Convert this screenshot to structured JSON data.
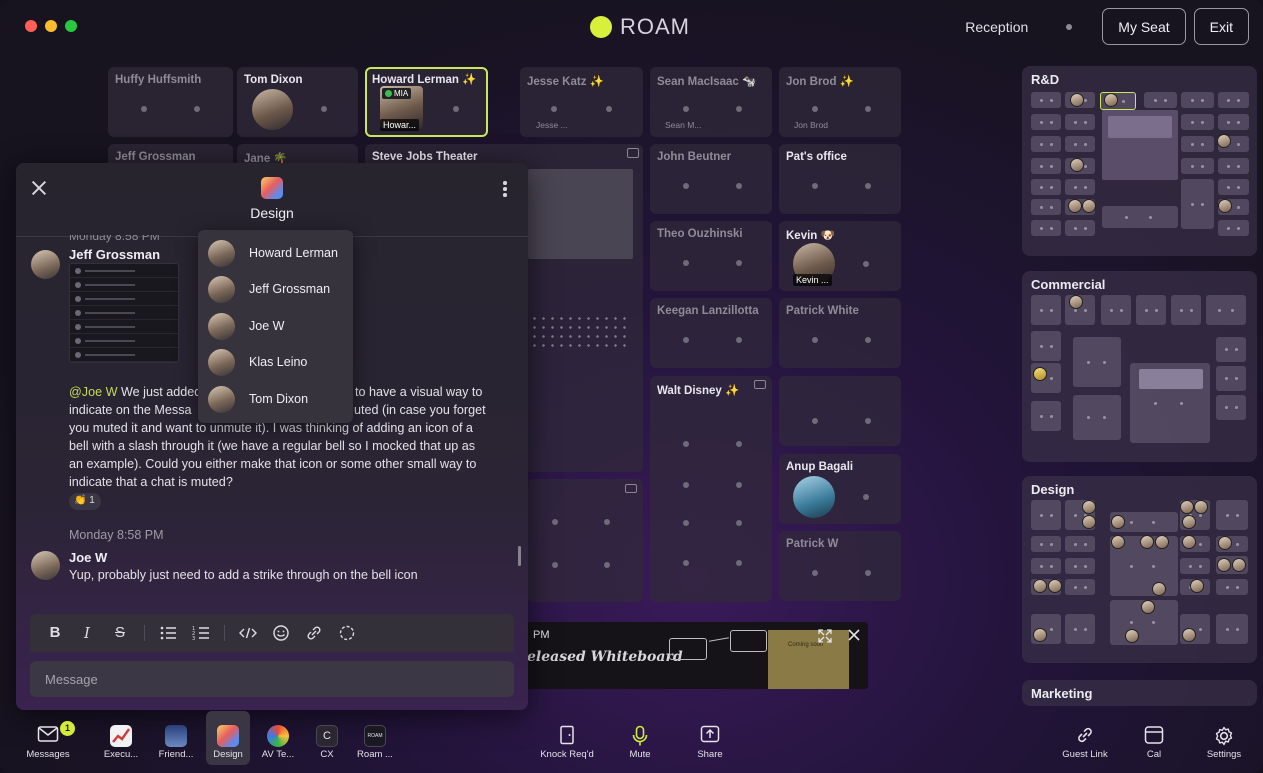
{
  "app": {
    "name": "ROAM",
    "location": "Reception"
  },
  "header": {
    "my_seat": "My Seat",
    "exit": "Exit"
  },
  "rooms": [
    {
      "name": "Huffy Huffsmith"
    },
    {
      "name": "Tom Dixon"
    },
    {
      "name": "Howard Lerman ✨",
      "badge": "MIA",
      "caption": "Howar..."
    },
    {
      "name": "Jesse Katz ✨",
      "caption": "Jesse ..."
    },
    {
      "name": "Sean MacIsaac 🐄",
      "caption": "Sean M..."
    },
    {
      "name": "Jon Brod ✨",
      "caption": "Jon Brod"
    },
    {
      "name": "Jeff Grossman"
    },
    {
      "name": "Jane 🌴"
    },
    {
      "name": "Steve Jobs Theater"
    },
    {
      "name": "John Beutner"
    },
    {
      "name": "Pat's office"
    },
    {
      "name": "Theo Ouzhinski"
    },
    {
      "name": "Kevin 🐶",
      "caption": "Kevin ..."
    },
    {
      "name": "Keegan Lanzillotta"
    },
    {
      "name": "Patrick White"
    },
    {
      "name": "Walt Disney ✨"
    },
    {
      "name": "Anup Bagali"
    },
    {
      "name": "Patrick W"
    }
  ],
  "floors": [
    {
      "name": "R&D"
    },
    {
      "name": "Commercial"
    },
    {
      "name": "Design"
    },
    {
      "name": "Marketing"
    }
  ],
  "chat": {
    "title": "Design",
    "partial_header": "Monday 8:58 PM",
    "messages": [
      {
        "author": "Jeff Grossman",
        "mention": "@Joe W",
        "lines": [
          " We just added",
          "indicate on the Messa",
          "you muted it and want to unmute it). I was thinking of adding an icon of a",
          "bell with a slash through it (we have a regular bell so I mocked that up as",
          "an example). Could you either make that icon or some other small way to",
          "indicate that a chat is muted?"
        ],
        "line1_tail": "to have a visual way to",
        "line2_tail": "uted (in case you forget",
        "reaction": {
          "emoji": "👏",
          "count": "1"
        }
      },
      {
        "author": "Joe W",
        "text": "Yup, probably just need to add a strike through on the bell icon"
      }
    ],
    "date_separator": "Monday 8:58 PM",
    "input_placeholder": "Message",
    "toolbar": {
      "bold": "B",
      "italic": "I",
      "strike": "S"
    }
  },
  "members": [
    "Howard Lerman",
    "Jeff Grossman",
    "Joe W",
    "Klas Leino",
    "Tom Dixon"
  ],
  "whiteboard": {
    "time": "PM",
    "title": "eleased Whiteboard",
    "note": "Coming soon"
  },
  "bottom_bar": {
    "left": [
      {
        "label": "Messages",
        "badge": "1"
      },
      {
        "label": "Execu..."
      },
      {
        "label": "Friend..."
      },
      {
        "label": "Design"
      },
      {
        "label": "AV Te..."
      },
      {
        "label": "CX",
        "letter": "C"
      },
      {
        "label": "Roam ...",
        "mini": "ROAM"
      }
    ],
    "center": [
      {
        "label": "Knock Req'd"
      },
      {
        "label": "Mute"
      },
      {
        "label": "Share"
      }
    ],
    "right": [
      {
        "label": "Guest Link"
      },
      {
        "label": "Cal"
      },
      {
        "label": "Settings"
      }
    ]
  },
  "colors": {
    "accent": "#d8f03c",
    "mention": "#c3dd54",
    "active_border": "#c8e75a"
  }
}
